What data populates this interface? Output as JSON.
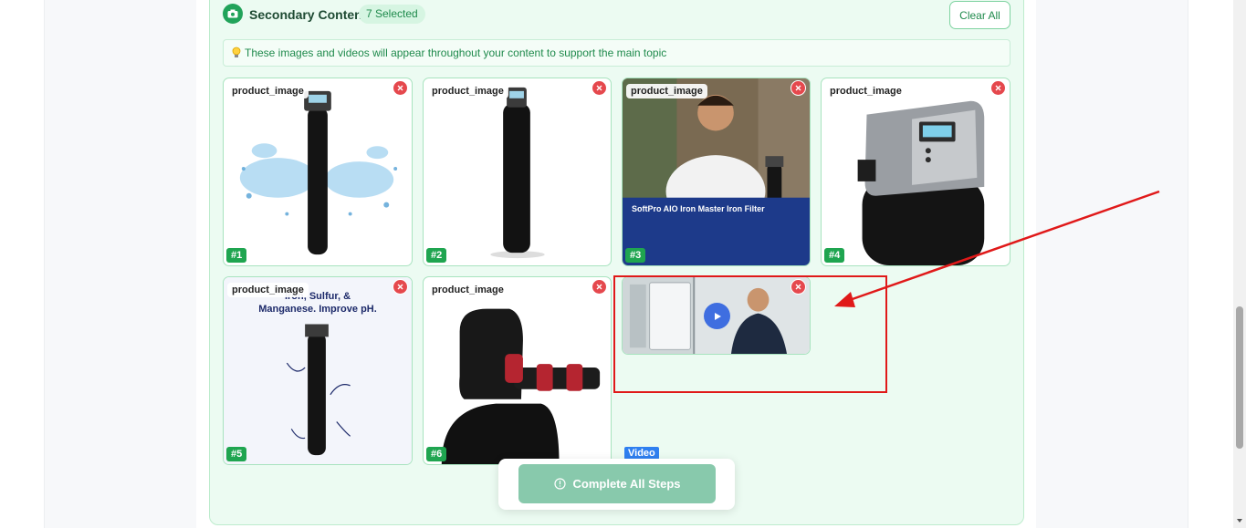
{
  "header": {
    "title": "Secondary Content",
    "selected_badge": "7 Selected",
    "clear_all_label": "Clear All",
    "icon": "camera-icon"
  },
  "info": {
    "icon": "lightbulb-icon",
    "text": "These images and videos will appear throughout your content to support the main topic"
  },
  "items": [
    {
      "label": "product_image",
      "number": "#1"
    },
    {
      "label": "product_image",
      "number": "#2"
    },
    {
      "label": "product_image",
      "number": "#3",
      "image_text": {
        "title": "SoftPro AIO Iron Master Iron Filter"
      }
    },
    {
      "label": "product_image",
      "number": "#4"
    },
    {
      "label": "product_image",
      "number": "#5",
      "image_text": {
        "headline_1": "Iron, Sulfur, &",
        "headline_2": "Manganese. Improve pH."
      }
    },
    {
      "label": "product_image",
      "number": "#6"
    },
    {
      "type_badge": "Video",
      "icon": "play-icon"
    }
  ],
  "footer": {
    "cta_label": "Complete All Steps",
    "cta_icon": "alert-circle-icon"
  },
  "colors": {
    "accent": "#21a35a",
    "remove": "#e5484d",
    "video_badge": "#2f7ff0",
    "annotation": "#e01919"
  }
}
